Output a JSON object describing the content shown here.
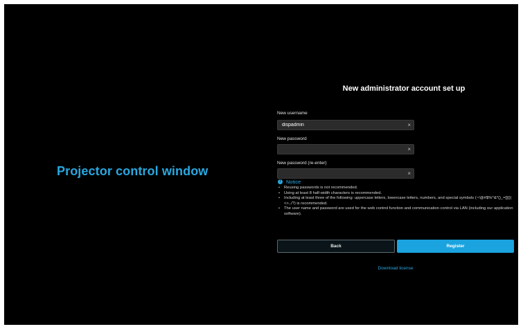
{
  "app": {
    "title": "Projector control window"
  },
  "form": {
    "heading": "New administrator account set up",
    "username": {
      "label": "New username",
      "value": "dispadmin",
      "clear": "×"
    },
    "password": {
      "label": "New password",
      "value": "",
      "clear": "×"
    },
    "password_confirm": {
      "label": "New password (re-enter)",
      "value": "",
      "clear": "×"
    }
  },
  "notice": {
    "icon": "!",
    "title": "Notice",
    "items": [
      "Reusing passwords is not recommended.",
      "Using at least 8 half-width characters is recommended.",
      "Including at least three of the following: uppercase letters, lowercase letters, numbers, and special symbols (~!@#$%^&*()_=[]{}|<>,./?) is recommended.",
      "The user name and password are used for the web control function and communication control via LAN (including our application software)."
    ]
  },
  "buttons": {
    "back": "Back",
    "register": "Register"
  },
  "links": {
    "download_license": "Download license"
  },
  "colors": {
    "accent": "#29a8e0",
    "background": "#000000",
    "field": "#2b2b2b"
  },
  "icons": {
    "notice": "info-icon",
    "clear": "close-icon"
  }
}
